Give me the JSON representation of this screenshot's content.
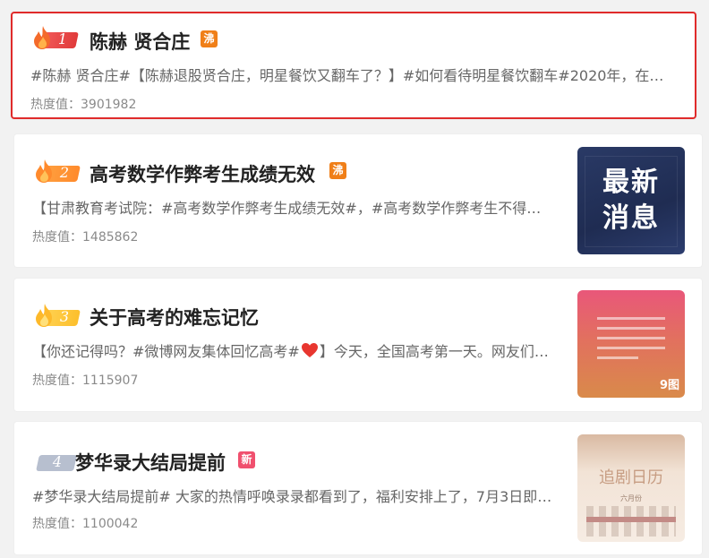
{
  "items": [
    {
      "rank": "1",
      "title": "陈赫 贤合庄",
      "tag": "沸",
      "desc": "#陈赫 贤合庄#【陈赫退股贤合庄，明星餐饮又翻车了？】#如何看待明星餐饮翻车#2020年，在…",
      "heat": "热度值：3901982",
      "selected": true
    },
    {
      "rank": "2",
      "title": "高考数学作弊考生成绩无效",
      "tag": "沸",
      "desc": "【甘肃教育考试院：#高考数学作弊考生成绩无效#，#高考数学作弊考生不得…",
      "heat": "热度值：1485862",
      "thumb": {
        "line1": "最新",
        "line2": "消息"
      }
    },
    {
      "rank": "3",
      "title": "关于高考的难忘记忆",
      "desc_before": "【你还记得吗？#微博网友集体回忆高考#",
      "desc_after": "】今天，全国高考第一天。网友们…",
      "heat": "热度值：1115907",
      "thumb": {
        "count": "9图"
      }
    },
    {
      "rank": "4",
      "title": "梦华录大结局提前",
      "tag": "新",
      "desc": "#梦华录大结局提前# 大家的热情呼唤录录都看到了，福利安排上了，7月3日即…",
      "heat": "热度值：1100042",
      "thumb": {
        "title": "追剧日历",
        "month": "六月份"
      }
    }
  ],
  "colors": {
    "selected_border": "#e02b2b",
    "tag_hot": "#f07f18",
    "tag_new": "#f0506e",
    "rank1": "#f04343",
    "rank2": "#ff8a2c",
    "rank3": "#fcc33c",
    "rank_other": "#b7bfcf"
  }
}
